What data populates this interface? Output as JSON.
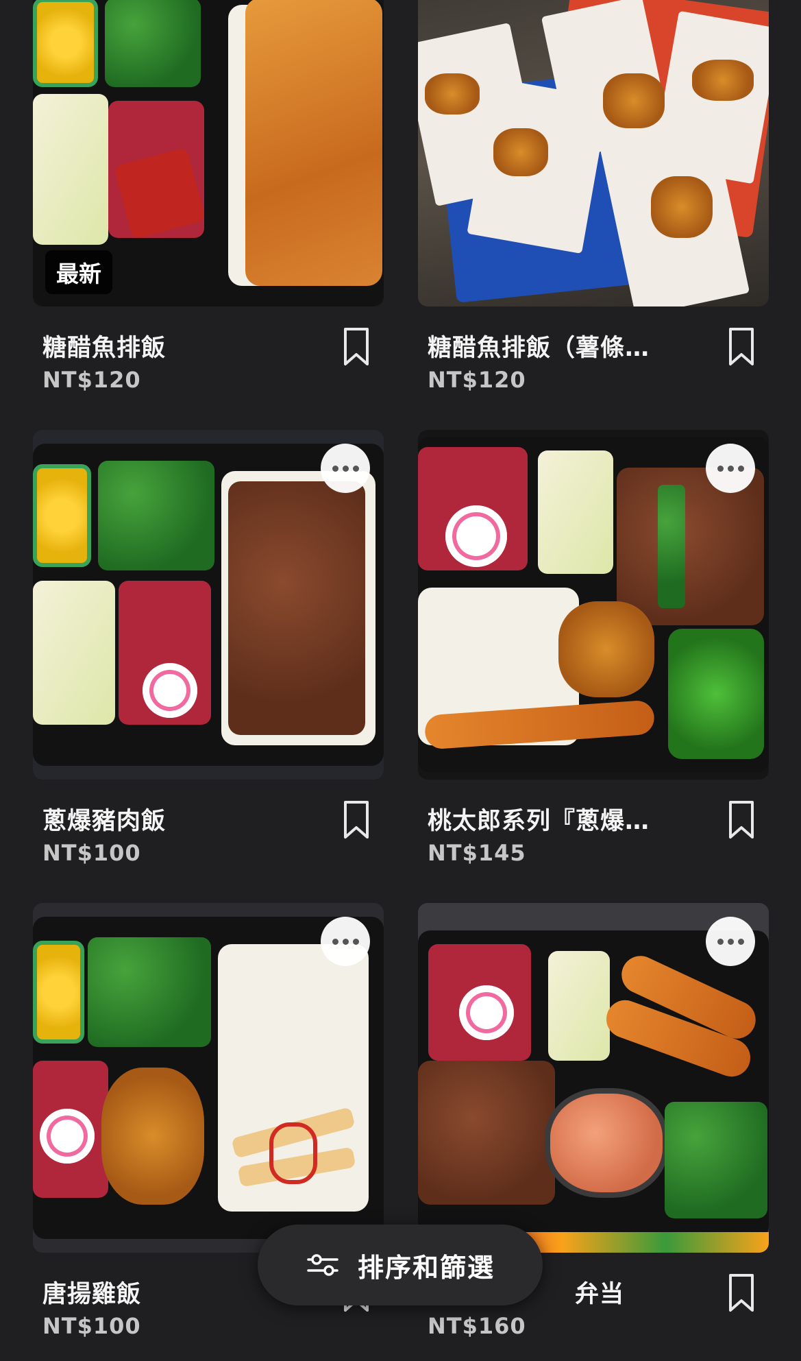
{
  "products": [
    {
      "name": "糖醋魚排飯",
      "price": "NT$120",
      "badge": "最新"
    },
    {
      "name": "糖醋魚排飯（薯條…",
      "price": "NT$120",
      "badge": ""
    },
    {
      "name": "蔥爆豬肉飯",
      "price": "NT$100",
      "badge": ""
    },
    {
      "name": "桃太郎系列『蔥爆…",
      "price": "NT$145",
      "badge": ""
    },
    {
      "name": "唐揚雞飯",
      "price": "NT$100",
      "badge": ""
    },
    {
      "name": "弁当",
      "price": "NT$160",
      "badge": ""
    }
  ],
  "sort_filter": {
    "label": "排序和篩選",
    "icon": "sliders-icon"
  },
  "icons": {
    "bookmark": "bookmark-icon",
    "more": "more-options-icon"
  },
  "colors": {
    "background": "#1f1f21",
    "text": "#f4f4f4",
    "price": "#c6c6c6"
  }
}
